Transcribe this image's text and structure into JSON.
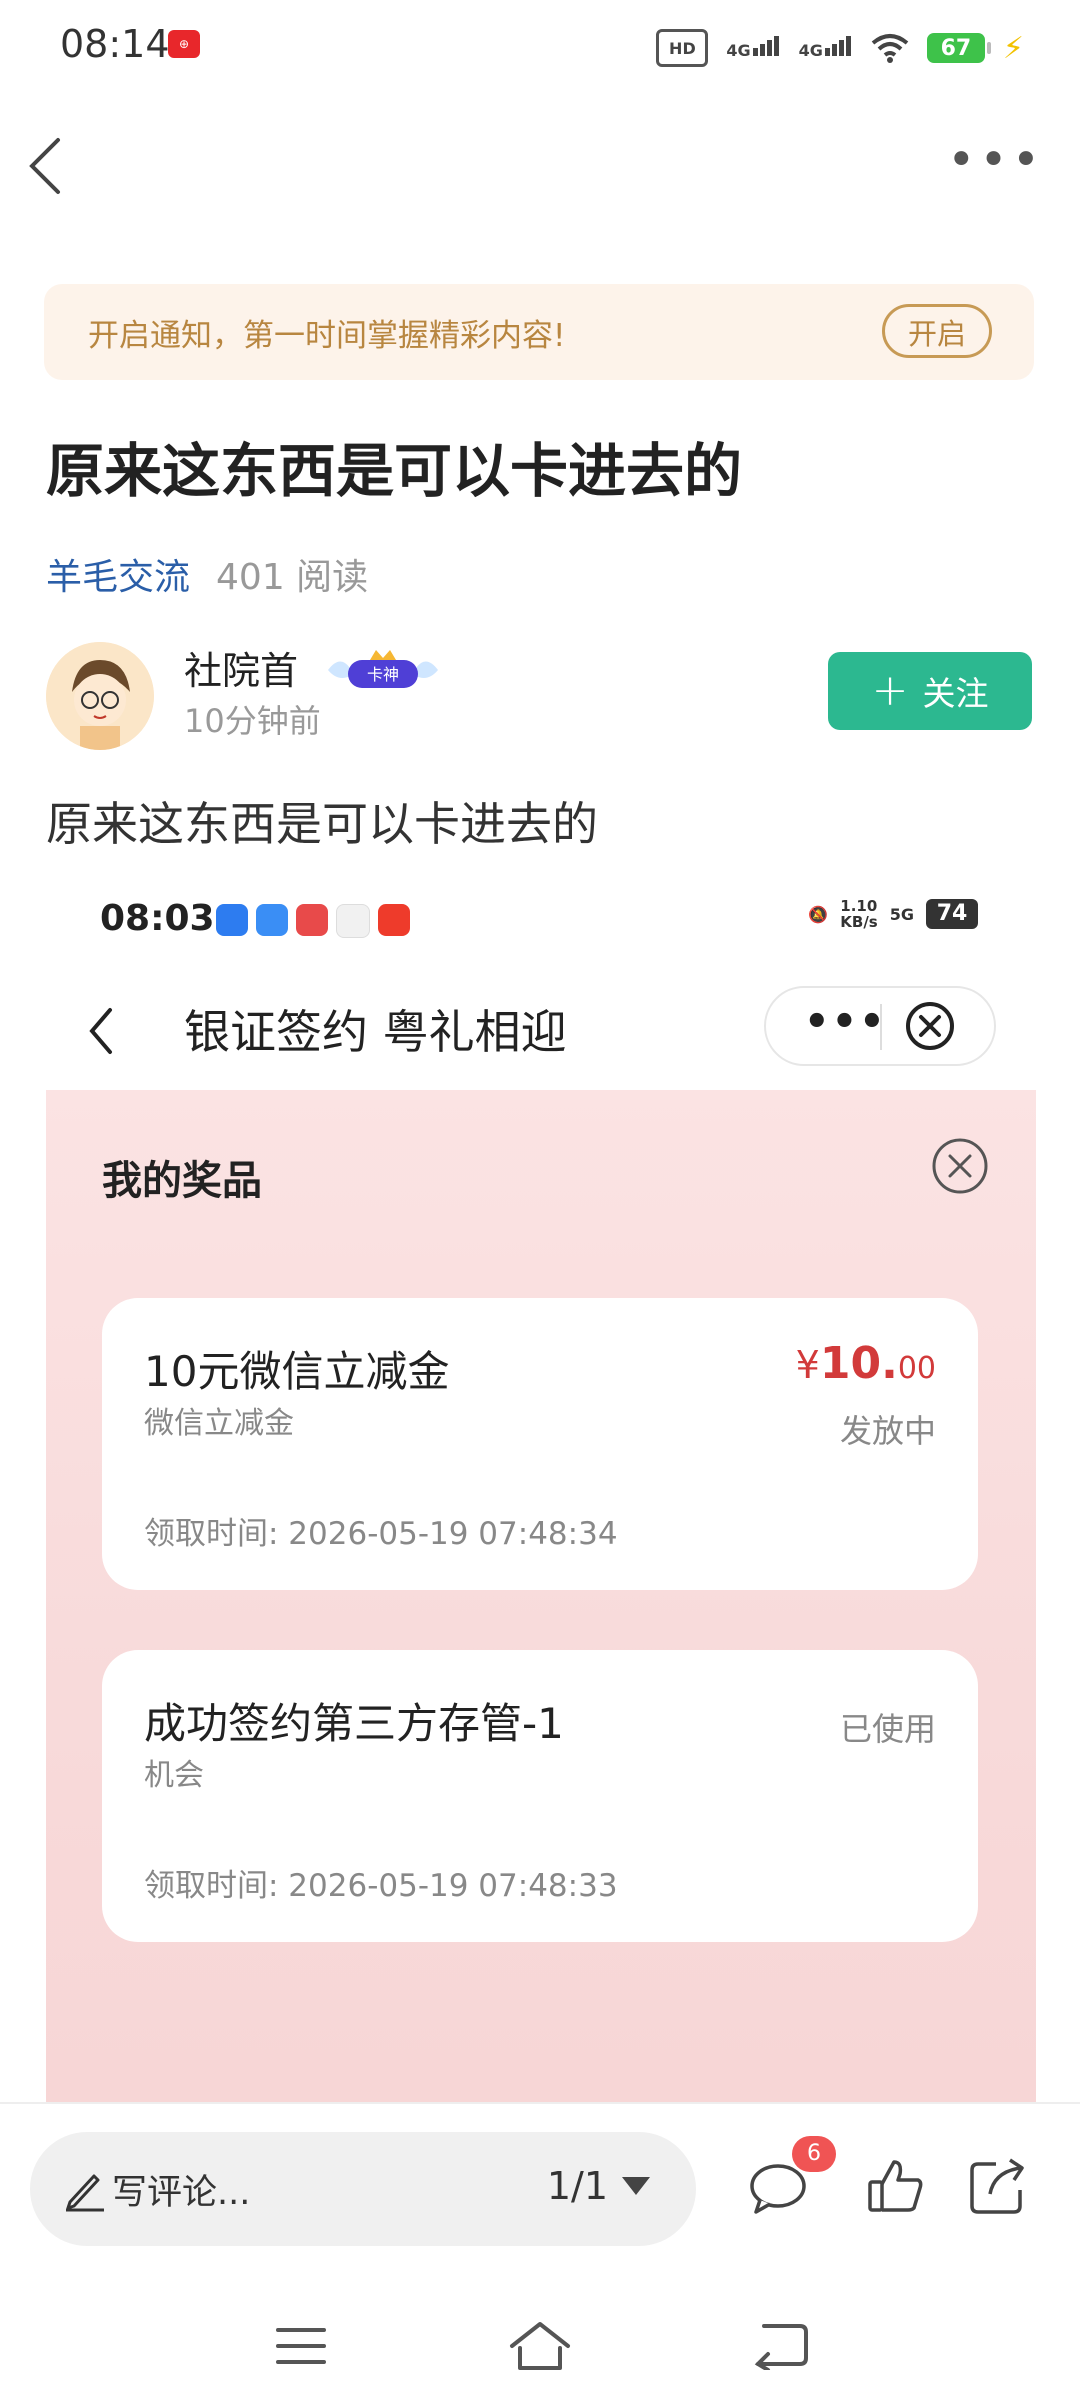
{
  "status_bar": {
    "time": "08:14",
    "battery": "67",
    "network_1": "4G",
    "network_2": "4G",
    "hd": "HD"
  },
  "nav": {
    "back_icon": "chevron-left-icon",
    "more_icon": "more-horizontal-icon"
  },
  "notify_banner": {
    "text": "开启通知，第一时间掌握精彩内容!",
    "button": "开启"
  },
  "article": {
    "title": "原来这东西是可以卡进去的",
    "category": "羊毛交流",
    "reads": "401 阅读",
    "author": "社院首",
    "badge": "卡神",
    "time_ago": "10分钟前",
    "follow_button": "关注",
    "body": "原来这东西是可以卡进去的"
  },
  "screenshot": {
    "status_time": "08:03",
    "speed": "1.10",
    "speed_unit": "KB/s",
    "network": "5G",
    "battery": "74",
    "page_title": "银证签约 粤礼相迎",
    "panel_title": "我的奖品",
    "prizes": [
      {
        "name": "10元微信立减金",
        "subtitle": "微信立减金",
        "currency": "¥",
        "amount_int": "10.",
        "amount_dec": "00",
        "status": "发放中",
        "time": "领取时间: 2026-05-19 07:48:34"
      },
      {
        "name": "成功签约第三方存管-1",
        "subtitle": "机会",
        "status": "已使用",
        "time": "领取时间: 2026-05-19 07:48:33"
      }
    ]
  },
  "bottom_bar": {
    "comment_placeholder": "写评论...",
    "page_indicator": "1/1",
    "comment_count": "6"
  },
  "colors": {
    "accent_green": "#2cb890",
    "link_blue": "#2a5ea8",
    "banner_text": "#b88640",
    "price_red": "#d23a3a"
  }
}
